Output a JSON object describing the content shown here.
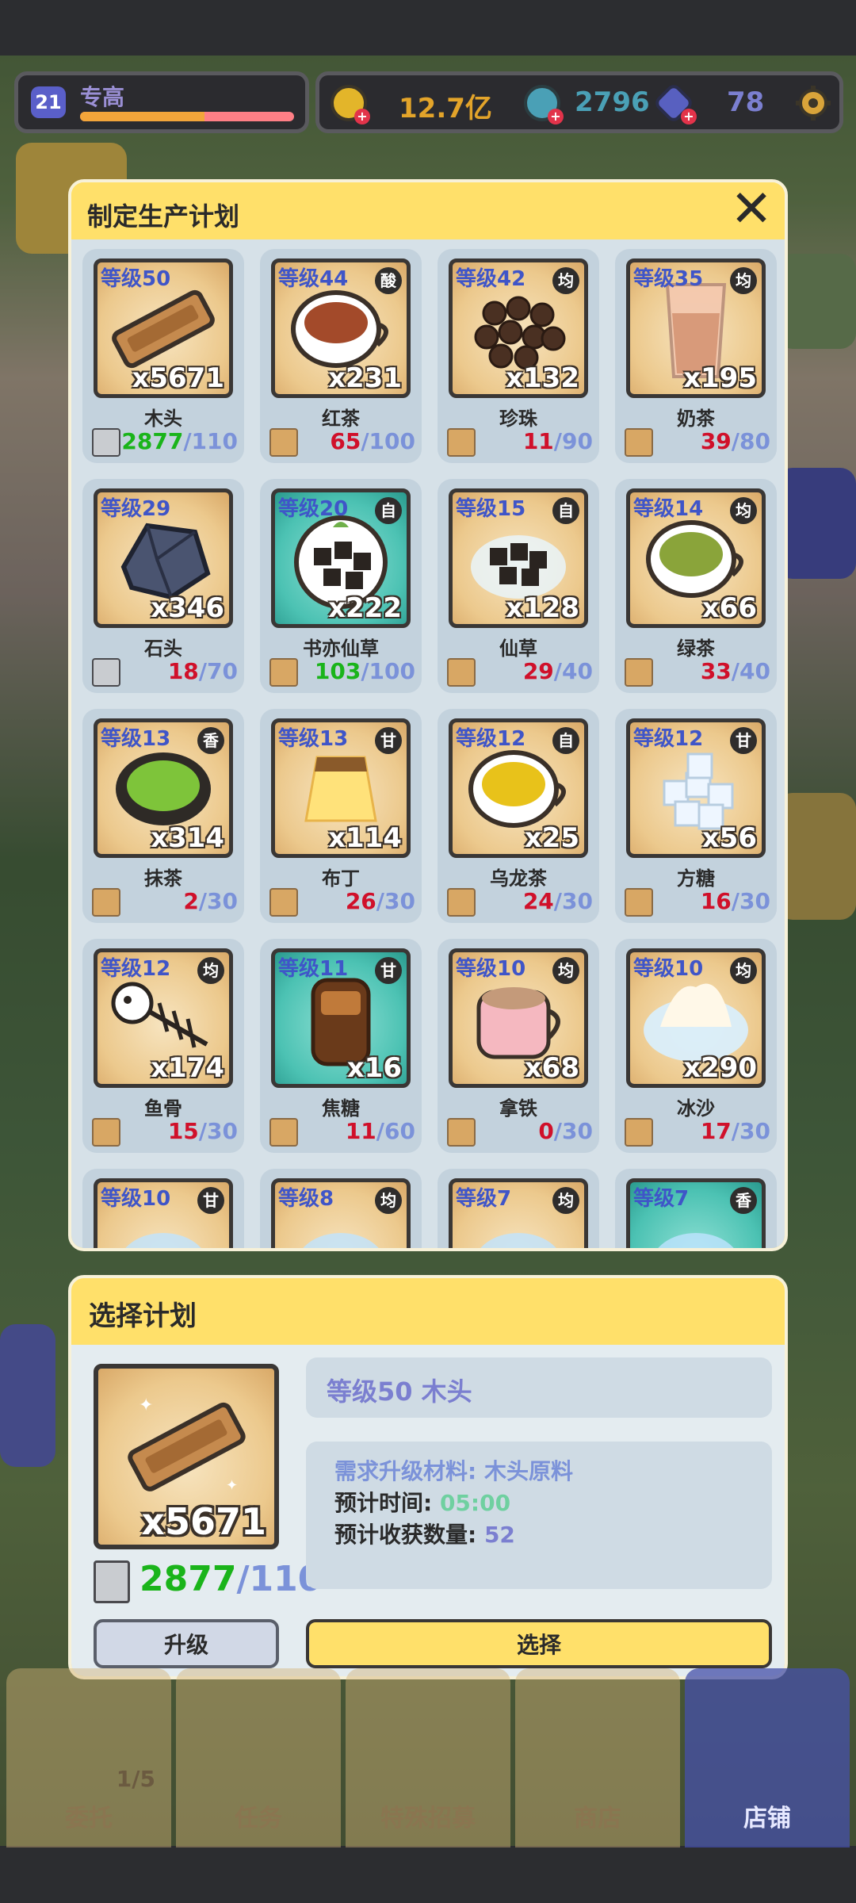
{
  "hud": {
    "player_level": "21",
    "player_name": "专高",
    "xp_progress": 0.58,
    "gold": "12.7亿",
    "gems": "2796",
    "crystals": "78"
  },
  "plan_panel": {
    "title": "制定生产计划",
    "items": [
      {
        "level": "等级50",
        "tag": "",
        "qty": "x5671",
        "name": "木头",
        "have": "2877",
        "need": "/110",
        "ok": true,
        "art": "wood",
        "teal": false,
        "mat": "gray"
      },
      {
        "level": "等级44",
        "tag": "酸",
        "qty": "x231",
        "name": "红茶",
        "have": "65",
        "need": "/100",
        "ok": false,
        "art": "redtea",
        "teal": false,
        "mat": "box"
      },
      {
        "level": "等级42",
        "tag": "均",
        "qty": "x132",
        "name": "珍珠",
        "have": "11",
        "need": "/90",
        "ok": false,
        "art": "pearl",
        "teal": false,
        "mat": "box"
      },
      {
        "level": "等级35",
        "tag": "均",
        "qty": "x195",
        "name": "奶茶",
        "have": "39",
        "need": "/80",
        "ok": false,
        "art": "milktea",
        "teal": false,
        "mat": "box"
      },
      {
        "level": "等级29",
        "tag": "",
        "qty": "x346",
        "name": "石头",
        "have": "18",
        "need": "/70",
        "ok": false,
        "art": "stone",
        "teal": false,
        "mat": "gray"
      },
      {
        "level": "等级20",
        "tag": "自",
        "qty": "x222",
        "name": "书亦仙草",
        "have": "103",
        "need": "/100",
        "ok": true,
        "art": "grassjelly",
        "teal": true,
        "mat": "box"
      },
      {
        "level": "等级15",
        "tag": "自",
        "qty": "x128",
        "name": "仙草",
        "have": "29",
        "need": "/40",
        "ok": false,
        "art": "grassjelly2",
        "teal": false,
        "mat": "box"
      },
      {
        "level": "等级14",
        "tag": "均",
        "qty": "x66",
        "name": "绿茶",
        "have": "33",
        "need": "/40",
        "ok": false,
        "art": "greentea",
        "teal": false,
        "mat": "box"
      },
      {
        "level": "等级13",
        "tag": "香",
        "qty": "x314",
        "name": "抹茶",
        "have": "2",
        "need": "/30",
        "ok": false,
        "art": "matcha",
        "teal": false,
        "mat": "box"
      },
      {
        "level": "等级13",
        "tag": "甘",
        "qty": "x114",
        "name": "布丁",
        "have": "26",
        "need": "/30",
        "ok": false,
        "art": "pudding",
        "teal": false,
        "mat": "box"
      },
      {
        "level": "等级12",
        "tag": "自",
        "qty": "x25",
        "name": "乌龙茶",
        "have": "24",
        "need": "/30",
        "ok": false,
        "art": "oolong",
        "teal": false,
        "mat": "box"
      },
      {
        "level": "等级12",
        "tag": "甘",
        "qty": "x56",
        "name": "方糖",
        "have": "16",
        "need": "/30",
        "ok": false,
        "art": "sugar",
        "teal": false,
        "mat": "box"
      },
      {
        "level": "等级12",
        "tag": "均",
        "qty": "x174",
        "name": "鱼骨",
        "have": "15",
        "need": "/30",
        "ok": false,
        "art": "fishbone",
        "teal": false,
        "mat": "box"
      },
      {
        "level": "等级11",
        "tag": "甘",
        "qty": "x16",
        "name": "焦糖",
        "have": "11",
        "need": "/60",
        "ok": false,
        "art": "caramel",
        "teal": true,
        "mat": "box"
      },
      {
        "level": "等级10",
        "tag": "均",
        "qty": "x68",
        "name": "拿铁",
        "have": "0",
        "need": "/30",
        "ok": false,
        "art": "latte",
        "teal": false,
        "mat": "box"
      },
      {
        "level": "等级10",
        "tag": "均",
        "qty": "x290",
        "name": "冰沙",
        "have": "17",
        "need": "/30",
        "ok": false,
        "art": "ice",
        "teal": false,
        "mat": "box"
      },
      {
        "level": "等级10",
        "tag": "甘",
        "qty": "",
        "name": "",
        "have": "",
        "need": "",
        "ok": false,
        "art": "partial",
        "teal": false,
        "mat": ""
      },
      {
        "level": "等级8",
        "tag": "均",
        "qty": "",
        "name": "",
        "have": "",
        "need": "",
        "ok": false,
        "art": "partial",
        "teal": false,
        "mat": ""
      },
      {
        "level": "等级7",
        "tag": "均",
        "qty": "",
        "name": "",
        "have": "",
        "need": "",
        "ok": false,
        "art": "partial",
        "teal": false,
        "mat": ""
      },
      {
        "level": "等级7",
        "tag": "香",
        "qty": "",
        "name": "",
        "have": "",
        "need": "",
        "ok": false,
        "art": "partial",
        "teal": true,
        "mat": ""
      }
    ]
  },
  "select_panel": {
    "title": "选择计划",
    "qty": "x5671",
    "have": "2877",
    "need": "/110",
    "name": "等级50  木头",
    "req_label": "需求升级材料:",
    "req_value": "木头原料",
    "time_label": "预计时间:",
    "time_value": "05:00",
    "yield_label": "预计收获数量:",
    "yield_value": "52",
    "upgrade_label": "升级",
    "select_label": "选择"
  },
  "nav": [
    {
      "label": "委托",
      "count": "1/5"
    },
    {
      "label": "任务",
      "count": ""
    },
    {
      "label": "特殊招募",
      "count": ""
    },
    {
      "label": "商店",
      "count": ""
    },
    {
      "label": "店铺",
      "count": ""
    }
  ],
  "colors": {
    "panel_yellow": "#ffe06a",
    "grid_bg": "#d6e1e8",
    "level_blue": "#3f55c8",
    "count_red": "#d0102a",
    "count_green": "#1ab41a",
    "need_blue": "#7b92d9"
  }
}
